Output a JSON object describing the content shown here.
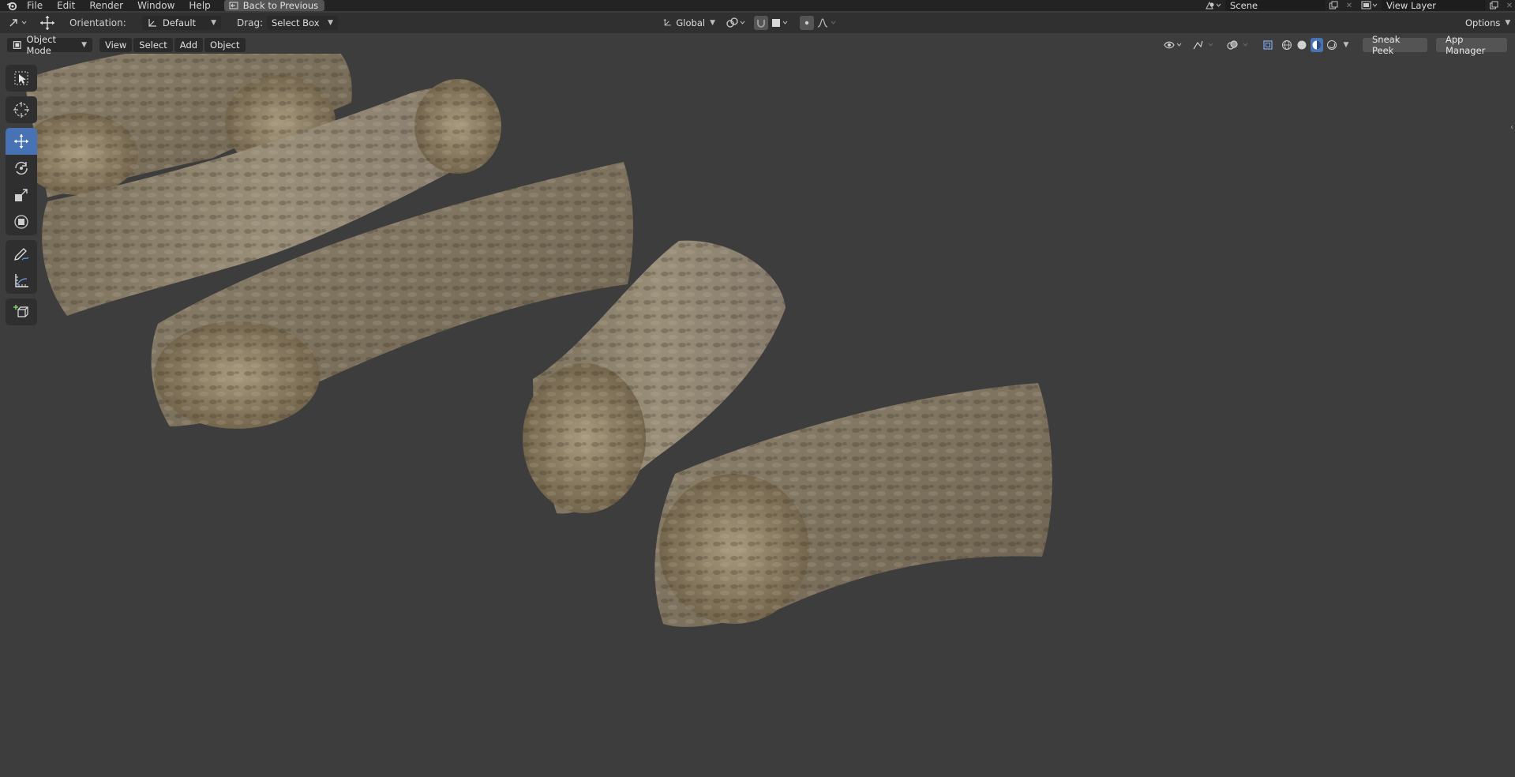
{
  "menubar": {
    "items": [
      "File",
      "Edit",
      "Render",
      "Window",
      "Help"
    ],
    "back_button": "Back to Previous",
    "scene_name": "Scene",
    "view_layer_name": "View Layer"
  },
  "tool_header": {
    "orientation_label": "Orientation:",
    "orientation_value": "Default",
    "drag_label": "Drag:",
    "drag_value": "Select Box",
    "transform_orientation": "Global",
    "options_label": "Options"
  },
  "view_header": {
    "mode": "Object Mode",
    "menus": [
      "View",
      "Select",
      "Add",
      "Object"
    ],
    "sneak_peek": "Sneak Peek",
    "app_manager": "App Manager"
  },
  "toolbar": {
    "tools": [
      "select-box",
      "cursor",
      "move",
      "rotate",
      "scale",
      "transform",
      "annotate",
      "measure",
      "add-cube"
    ],
    "active_tool": "move"
  },
  "colors": {
    "accent": "#4772b3",
    "viewport_bg": "#3d3d3d",
    "header_bg": "#303030",
    "topbar_bg": "#232323",
    "log_bark": "#8a7d66"
  },
  "icons": {
    "logo": "blender-logo-icon",
    "back": "back-screen-icon",
    "scene": "scene-icon",
    "view_layer": "view-layer-icon"
  }
}
